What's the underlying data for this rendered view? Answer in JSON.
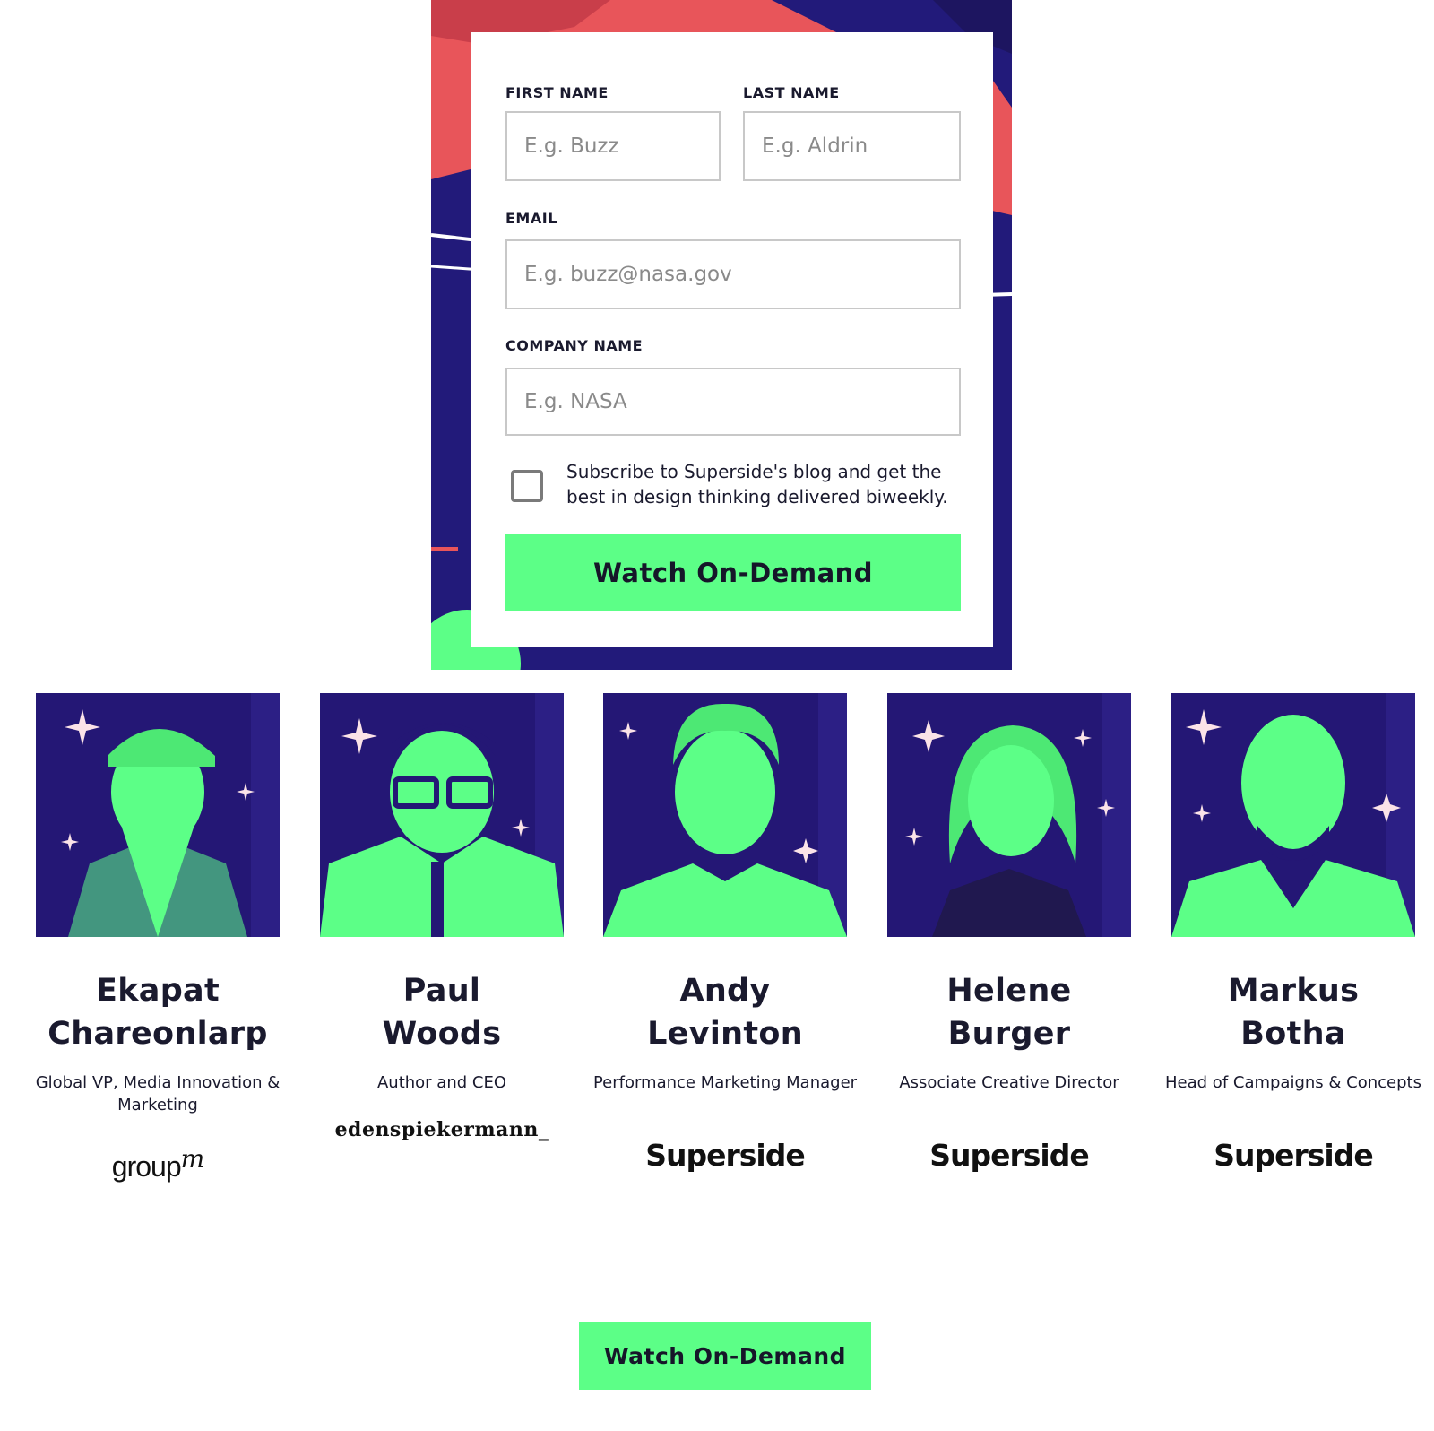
{
  "form": {
    "first_name": {
      "label": "FIRST NAME",
      "placeholder": "E.g. Buzz"
    },
    "last_name": {
      "label": "LAST NAME",
      "placeholder": "E.g. Aldrin"
    },
    "email": {
      "label": "EMAIL",
      "placeholder": "E.g. buzz@nasa.gov"
    },
    "company": {
      "label": "COMPANY NAME",
      "placeholder": "E.g. NASA"
    },
    "subscribe_text": "Subscribe to Superside's blog and get the best in design thinking delivered biweekly.",
    "submit_label": "Watch On-Demand"
  },
  "speakers": [
    {
      "first": "Ekapat",
      "last": "Chareonlarp",
      "title": "Global VP, Media Innovation & Marketing",
      "company_logo": "groupm"
    },
    {
      "first": "Paul",
      "last": "Woods",
      "title": "Author and CEO",
      "company_logo": "edenspiekermann_"
    },
    {
      "first": "Andy",
      "last": "Levinton",
      "title": "Performance Marketing Manager",
      "company_logo": "Superside"
    },
    {
      "first": "Helene",
      "last": "Burger",
      "title": "Associate Creative Director",
      "company_logo": "Superside"
    },
    {
      "first": "Markus",
      "last": "Botha",
      "title": "Head of Campaigns & Concepts",
      "company_logo": "Superside"
    }
  ],
  "cta": {
    "label": "Watch On-Demand"
  },
  "colors": {
    "accent_green": "#5cff87",
    "hero_purple": "#221a7a",
    "hero_coral": "#e8555a",
    "text_dark": "#1a1a2e"
  }
}
